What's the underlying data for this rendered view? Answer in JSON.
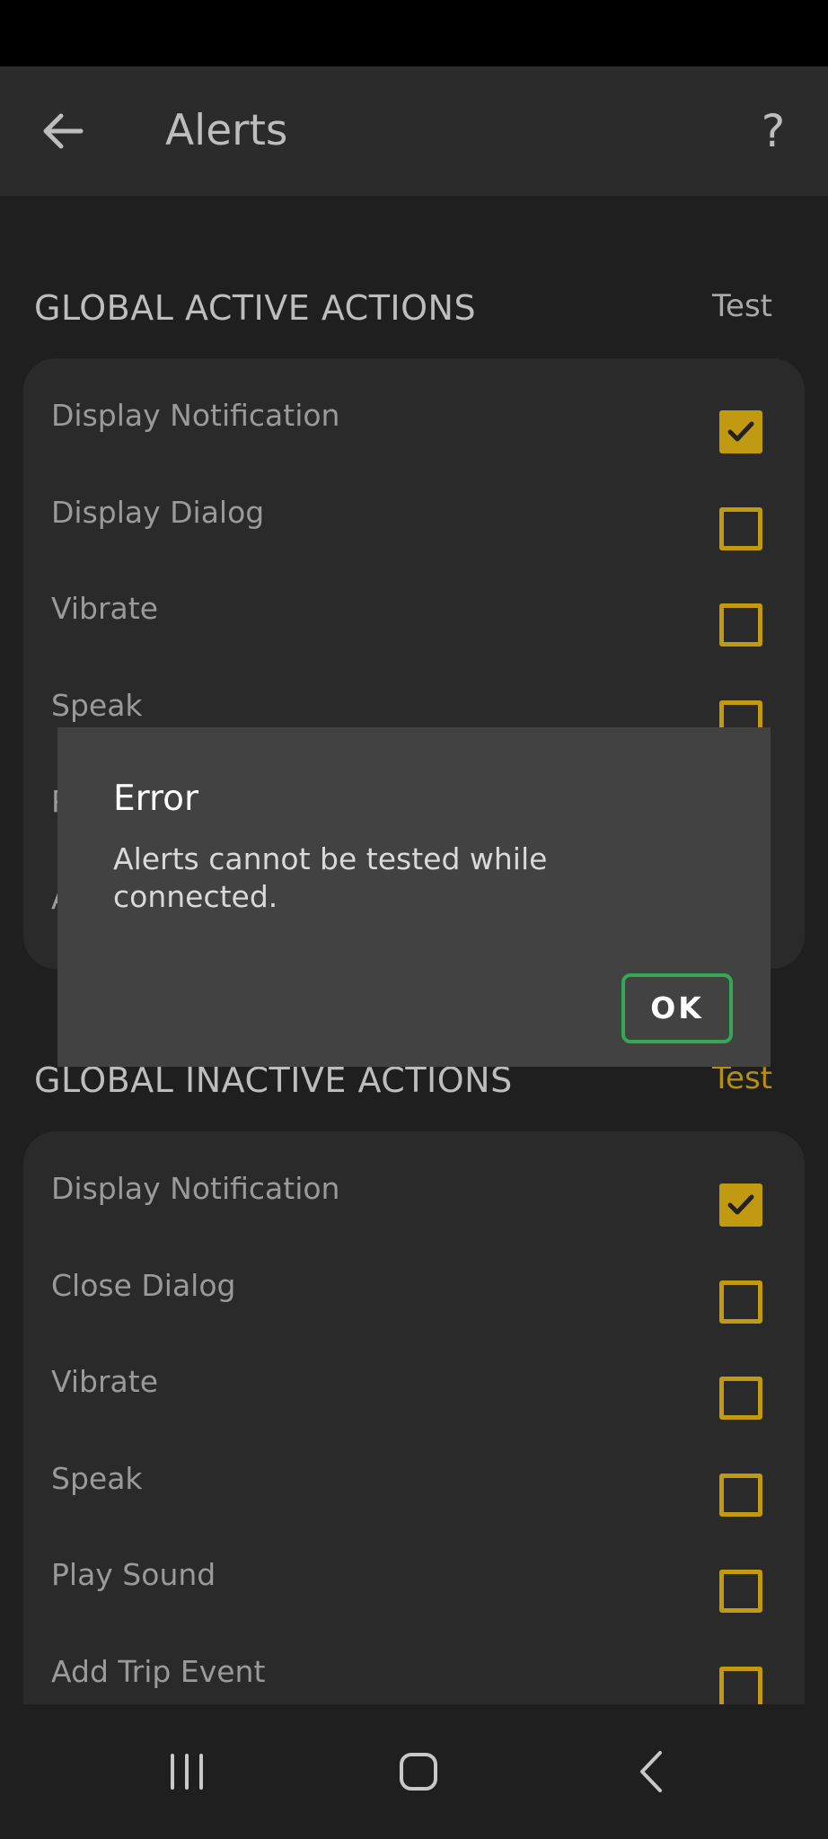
{
  "app_bar": {
    "title": "Alerts",
    "help_glyph": "?"
  },
  "sections": [
    {
      "header": "GLOBAL ACTIVE ACTIONS",
      "test_label": "Test",
      "test_color": "#a9a9a9",
      "items": [
        {
          "label": "Display Notification",
          "checked": true
        },
        {
          "label": "Display Dialog",
          "checked": false
        },
        {
          "label": "Vibrate",
          "checked": false
        },
        {
          "label": "Speak",
          "checked": false
        },
        {
          "label": "P",
          "checked": false
        },
        {
          "label": "A",
          "checked": false
        }
      ]
    },
    {
      "header": "GLOBAL INACTIVE ACTIONS",
      "test_label": "Test",
      "test_color": "#b58f12",
      "items": [
        {
          "label": "Display Notification",
          "checked": true
        },
        {
          "label": "Close Dialog",
          "checked": false
        },
        {
          "label": "Vibrate",
          "checked": false
        },
        {
          "label": "Speak",
          "checked": false
        },
        {
          "label": "Play Sound",
          "checked": false
        },
        {
          "label": "Add Trip Event",
          "checked": false
        }
      ]
    }
  ],
  "dialog": {
    "title": "Error",
    "message": "Alerts cannot be tested while connected.",
    "ok_label": "OK"
  },
  "nav": {
    "recent_icon": "recent-apps-icon",
    "home_icon": "home-icon",
    "back_icon": "back-icon"
  },
  "colors": {
    "accent": "#c29a12",
    "ok_border": "#35a853",
    "dialog_bg": "#424242",
    "card_bg": "#2a2a2a"
  }
}
